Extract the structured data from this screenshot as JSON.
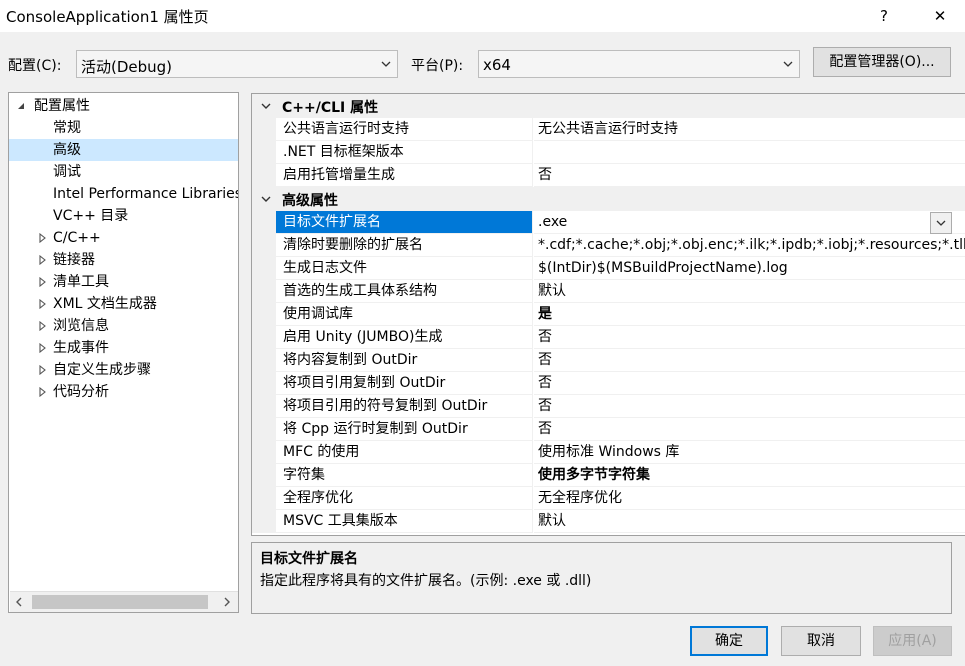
{
  "window": {
    "title": "ConsoleApplication1 属性页",
    "help_label": "?",
    "close_label": "✕"
  },
  "config_bar": {
    "config_label": "配置(C):",
    "config_value": "活动(Debug)",
    "platform_label": "平台(P):",
    "platform_value": "x64",
    "manager_button": "配置管理器(O)..."
  },
  "tree": {
    "root_label": "配置属性",
    "items": [
      {
        "label": "常规",
        "expandable": false,
        "selected": false
      },
      {
        "label": "高级",
        "expandable": false,
        "selected": true
      },
      {
        "label": "调试",
        "expandable": false,
        "selected": false
      },
      {
        "label": "Intel Performance Libraries",
        "expandable": false,
        "selected": false
      },
      {
        "label": "VC++ 目录",
        "expandable": false,
        "selected": false
      },
      {
        "label": "C/C++",
        "expandable": true,
        "selected": false
      },
      {
        "label": "链接器",
        "expandable": true,
        "selected": false
      },
      {
        "label": "清单工具",
        "expandable": true,
        "selected": false
      },
      {
        "label": "XML 文档生成器",
        "expandable": true,
        "selected": false
      },
      {
        "label": "浏览信息",
        "expandable": true,
        "selected": false
      },
      {
        "label": "生成事件",
        "expandable": true,
        "selected": false
      },
      {
        "label": "自定义生成步骤",
        "expandable": true,
        "selected": false
      },
      {
        "label": "代码分析",
        "expandable": true,
        "selected": false
      }
    ]
  },
  "grid": {
    "categories": [
      {
        "name": "C++/CLI 属性",
        "rows": [
          {
            "name": "公共语言运行时支持",
            "value": "无公共语言运行时支持",
            "bold": false
          },
          {
            "name": ".NET 目标框架版本",
            "value": "",
            "bold": false
          },
          {
            "name": "启用托管增量生成",
            "value": "否",
            "bold": false
          }
        ]
      },
      {
        "name": "高级属性",
        "rows": [
          {
            "name": "目标文件扩展名",
            "value": ".exe",
            "bold": false,
            "selected": true
          },
          {
            "name": "清除时要删除的扩展名",
            "value": "*.cdf;*.cache;*.obj;*.obj.enc;*.ilk;*.ipdb;*.iobj;*.resources;*.tlb",
            "bold": false
          },
          {
            "name": "生成日志文件",
            "value": "$(IntDir)$(MSBuildProjectName).log",
            "bold": false
          },
          {
            "name": "首选的生成工具体系结构",
            "value": "默认",
            "bold": false
          },
          {
            "name": "使用调试库",
            "value": "是",
            "bold": true
          },
          {
            "name": "启用 Unity (JUMBO)生成",
            "value": "否",
            "bold": false
          },
          {
            "name": "将内容复制到 OutDir",
            "value": "否",
            "bold": false
          },
          {
            "name": "将项目引用复制到 OutDir",
            "value": "否",
            "bold": false
          },
          {
            "name": "将项目引用的符号复制到 OutDir",
            "value": "否",
            "bold": false
          },
          {
            "name": "将 Cpp 运行时复制到 OutDir",
            "value": "否",
            "bold": false
          },
          {
            "name": "MFC 的使用",
            "value": "使用标准 Windows 库",
            "bold": false
          },
          {
            "name": "字符集",
            "value": "使用多字节字符集",
            "bold": true
          },
          {
            "name": "全程序优化",
            "value": "无全程序优化",
            "bold": false
          },
          {
            "name": "MSVC 工具集版本",
            "value": "默认",
            "bold": false
          }
        ]
      }
    ]
  },
  "description": {
    "title": "目标文件扩展名",
    "text": "指定此程序将具有的文件扩展名。(示例: .exe 或 .dll)"
  },
  "buttons": {
    "ok": "确定",
    "cancel": "取消",
    "apply": "应用(A)"
  },
  "colors": {
    "selection": "#0078d7",
    "tree_selection": "#cce8ff",
    "default_button_border": "#0078d7"
  }
}
